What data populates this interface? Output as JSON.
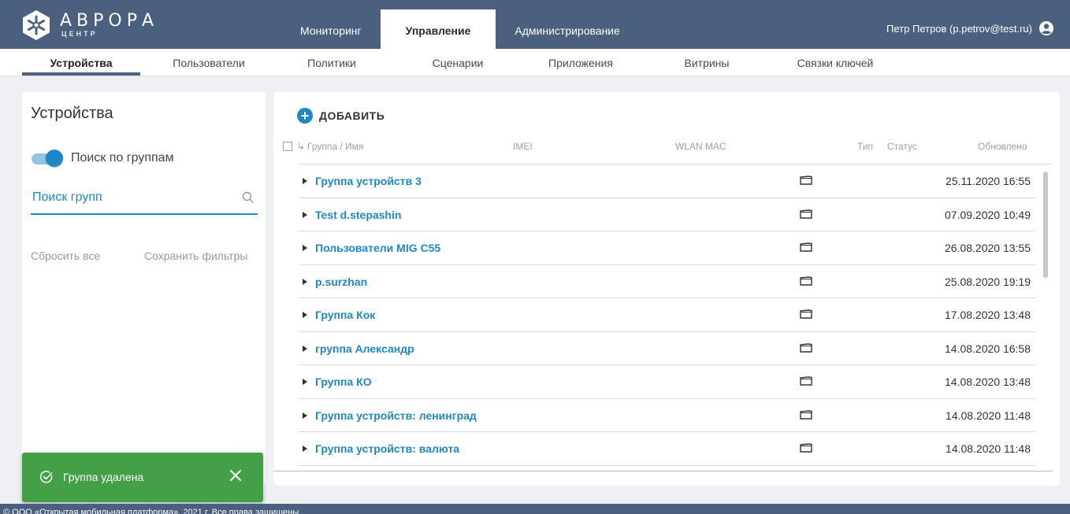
{
  "brand": {
    "name": "АВРОРА",
    "sub": "ЦЕНТР"
  },
  "topnav": {
    "tabs": [
      "Мониторинг",
      "Управление",
      "Администрирование"
    ],
    "active": 1
  },
  "user": {
    "name": "Петр Петров (p.petrov@test.ru)"
  },
  "subnav": {
    "items": [
      "Устройства",
      "Пользователи",
      "Политики",
      "Сценарии",
      "Приложения",
      "Витрины",
      "Связки ключей"
    ],
    "active": 0
  },
  "left": {
    "title": "Устройства",
    "toggle_label": "Поиск по группам",
    "toggle_on": true,
    "search_placeholder": "Поиск групп",
    "reset_label": "Сбросить все",
    "save_label": "Сохранить фильтры"
  },
  "main": {
    "add_label": "ДОБАВИТЬ",
    "columns": {
      "arrow": "↳",
      "name": "Группа / Имя",
      "imei": "IMEI",
      "wlan": "WLAN MAC",
      "type": "Тип",
      "status": "Статус",
      "updated": "Обновлено"
    },
    "rows": [
      {
        "name": "Группа устройств 3",
        "type_icon": "folder-icon",
        "updated": "25.11.2020 16:55"
      },
      {
        "name": "Test d.stepashin",
        "type_icon": "folder-icon",
        "updated": "07.09.2020 10:49"
      },
      {
        "name": "Пользователи MIG C55",
        "type_icon": "folder-icon",
        "updated": "26.08.2020 13:55"
      },
      {
        "name": "p.surzhan",
        "type_icon": "folder-icon",
        "updated": "25.08.2020 19:19"
      },
      {
        "name": "Группа Кок",
        "type_icon": "folder-icon",
        "updated": "17.08.2020 13:48"
      },
      {
        "name": "группа Александр",
        "type_icon": "folder-icon",
        "updated": "14.08.2020 16:58"
      },
      {
        "name": "Группа КО",
        "type_icon": "folder-icon",
        "updated": "14.08.2020 13:48"
      },
      {
        "name": "Группа устройств: ленинград",
        "type_icon": "folder-icon",
        "updated": "14.08.2020 11:48"
      },
      {
        "name": "Группа устройств: валюта",
        "type_icon": "folder-icon",
        "updated": "14.08.2020 11:48"
      }
    ]
  },
  "toast": {
    "message": "Группа удалена",
    "color": "#43a047"
  },
  "footer": {
    "text": "© ООО «Открытая мобильная платформа», 2021 г. Все права защищены"
  },
  "colors": {
    "header": "#4b5f7e",
    "accent": "#1e88c7"
  }
}
